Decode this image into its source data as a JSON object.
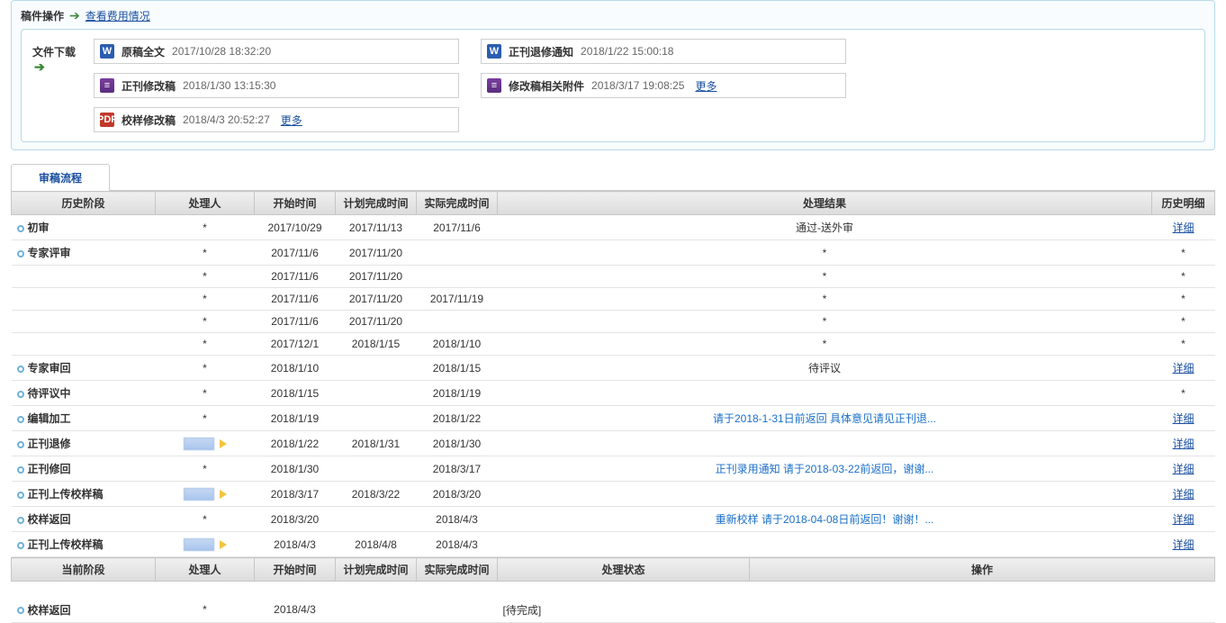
{
  "ops": {
    "label": "稿件操作",
    "link": "查看费用情况"
  },
  "dl": {
    "label": "文件下载",
    "more": "更多",
    "left": [
      {
        "icon": "word",
        "name": "原稿全文",
        "date": "2017/10/28 18:32:20",
        "more": false
      },
      {
        "icon": "rar",
        "name": "正刊修改稿",
        "date": "2018/1/30 13:15:30",
        "more": false
      },
      {
        "icon": "pdf",
        "name": "校样修改稿",
        "date": "2018/4/3 20:52:27",
        "more": true
      }
    ],
    "right": [
      {
        "icon": "word",
        "name": "正刊退修通知",
        "date": "2018/1/22 15:00:18",
        "more": false
      },
      {
        "icon": "rar",
        "name": "修改稿相关附件",
        "date": "2018/3/17 19:08:25",
        "more": true
      }
    ]
  },
  "tab": "审稿流程",
  "hist_hdr": {
    "stage": "历史阶段",
    "handler": "处理人",
    "start": "开始时间",
    "plan": "计划完成时间",
    "actual": "实际完成时间",
    "result": "处理结果",
    "detail": "历史明细"
  },
  "detail_text": "详细",
  "hist": [
    {
      "b": true,
      "stage": "初审",
      "handler": "*",
      "start": "2017/10/29",
      "plan": "2017/11/13",
      "actual": "2017/11/6",
      "result": "通过-送外审",
      "rlink": false,
      "detail": "link"
    },
    {
      "b": true,
      "stage": "专家评审",
      "handler": "*",
      "start": "2017/11/6",
      "plan": "2017/11/20",
      "actual": "",
      "result": "*",
      "rlink": false,
      "detail": "*"
    },
    {
      "b": false,
      "stage": "",
      "handler": "*",
      "start": "2017/11/6",
      "plan": "2017/11/20",
      "actual": "",
      "result": "*",
      "rlink": false,
      "detail": "*"
    },
    {
      "b": false,
      "stage": "",
      "handler": "*",
      "start": "2017/11/6",
      "plan": "2017/11/20",
      "actual": "2017/11/19",
      "result": "*",
      "rlink": false,
      "detail": "*"
    },
    {
      "b": false,
      "stage": "",
      "handler": "*",
      "start": "2017/11/6",
      "plan": "2017/11/20",
      "actual": "",
      "result": "*",
      "rlink": false,
      "detail": "*"
    },
    {
      "b": false,
      "stage": "",
      "handler": "*",
      "start": "2017/12/1",
      "plan": "2018/1/15",
      "actual": "2018/1/10",
      "result": "*",
      "rlink": false,
      "detail": "*"
    },
    {
      "b": true,
      "stage": "专家审回",
      "handler": "*",
      "start": "2018/1/10",
      "plan": "",
      "actual": "2018/1/15",
      "result": "待评议",
      "rlink": false,
      "detail": "link"
    },
    {
      "b": true,
      "stage": "待评议中",
      "handler": "*",
      "start": "2018/1/15",
      "plan": "",
      "actual": "2018/1/19",
      "result": "",
      "rlink": false,
      "detail": "*"
    },
    {
      "b": true,
      "stage": "编辑加工",
      "handler": "*",
      "start": "2018/1/19",
      "plan": "",
      "actual": "2018/1/22",
      "result": "请于2018-1-31日前返回 具体意见请见正刊退...",
      "rlink": true,
      "detail": "link"
    },
    {
      "b": true,
      "stage": "正刊退修",
      "handler": "blue",
      "start": "2018/1/22",
      "plan": "2018/1/31",
      "actual": "2018/1/30",
      "result": "",
      "rlink": false,
      "detail": "link"
    },
    {
      "b": true,
      "stage": "正刊修回",
      "handler": "*",
      "start": "2018/1/30",
      "plan": "",
      "actual": "2018/3/17",
      "result": "正刊录用通知 请于2018-03-22前返回，谢谢...",
      "rlink": true,
      "detail": "link"
    },
    {
      "b": true,
      "stage": "正刊上传校样稿",
      "handler": "blue",
      "start": "2018/3/17",
      "plan": "2018/3/22",
      "actual": "2018/3/20",
      "result": "",
      "rlink": false,
      "detail": "link"
    },
    {
      "b": true,
      "stage": "校样返回",
      "handler": "*",
      "start": "2018/3/20",
      "plan": "",
      "actual": "2018/4/3",
      "result": "重新校样 请于2018-04-08日前返回！谢谢！...",
      "rlink": true,
      "detail": "link"
    },
    {
      "b": true,
      "stage": "正刊上传校样稿",
      "handler": "blue",
      "start": "2018/4/3",
      "plan": "2018/4/8",
      "actual": "2018/4/3",
      "result": "",
      "rlink": false,
      "detail": "link"
    }
  ],
  "cur_hdr": {
    "stage": "当前阶段",
    "handler": "处理人",
    "start": "开始时间",
    "plan": "计划完成时间",
    "actual": "实际完成时间",
    "status": "处理状态",
    "op": "操作"
  },
  "cur": {
    "stage": "校样返回",
    "handler": "*",
    "start": "2018/4/3",
    "plan": "",
    "actual": "",
    "status": "[待完成]"
  }
}
